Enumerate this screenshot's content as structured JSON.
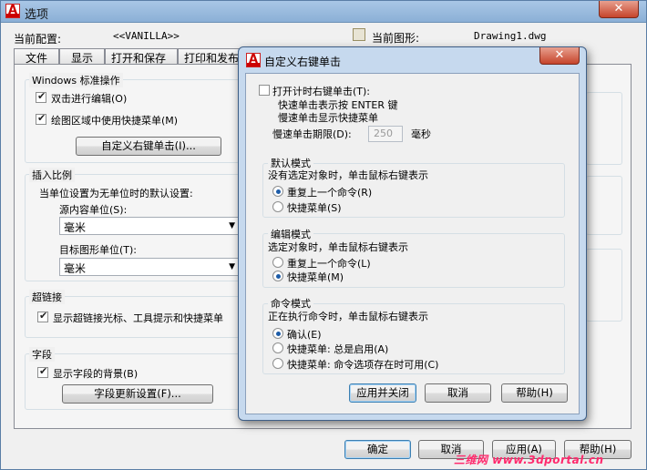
{
  "main": {
    "title": "选项",
    "close_label": "✕",
    "current_config_label": "当前配置:",
    "current_config_value": "<<VANILLA>>",
    "current_drawing_label": "当前图形:",
    "current_drawing_value": "Drawing1.dwg",
    "tabs": [
      "文件",
      "显示",
      "打开和保存",
      "打印和发布",
      "系"
    ],
    "windows_group": {
      "title": "Windows 标准操作",
      "double_click_edit": "双击进行编辑(O)",
      "shortcut_menu": "绘图区域中使用快捷菜单(M)",
      "custom_right_click_button": "自定义右键单击(I)..."
    },
    "insert_scale_group": {
      "title": "插入比例",
      "desc": "当单位设置为无单位时的默认设置:",
      "source_label": "源内容单位(S):",
      "source_value": "毫米",
      "target_label": "目标图形单位(T):",
      "target_value": "毫米"
    },
    "hyperlink_group": {
      "title": "超链接",
      "show_cursor": "显示超链接光标、工具提示和快捷菜单"
    },
    "field_group": {
      "title": "字段",
      "show_background": "显示字段的背景(B)",
      "update_settings_button": "字段更新设置(F)..."
    },
    "footer": {
      "ok": "确定",
      "cancel": "取消",
      "apply": "应用(A)",
      "help": "帮助(H)"
    }
  },
  "dialog": {
    "title": "自定义右键单击",
    "close_label": "✕",
    "timed_right_click": "打开计时右键单击(T):",
    "quick_click_desc": "快速单击表示按 ENTER 键",
    "slow_click_desc": "慢速单击显示快捷菜单",
    "slow_click_duration_label": "慢速单击期限(D):",
    "slow_click_duration_value": "250",
    "duration_unit": "毫秒",
    "default_mode": {
      "title": "默认模式",
      "desc": "没有选定对象时，单击鼠标右键表示",
      "options": [
        "重复上一个命令(R)",
        "快捷菜单(S)"
      ],
      "selected": 0
    },
    "edit_mode": {
      "title": "编辑模式",
      "desc": "选定对象时，单击鼠标右键表示",
      "options": [
        "重复上一个命令(L)",
        "快捷菜单(M)"
      ],
      "selected": 1
    },
    "command_mode": {
      "title": "命令模式",
      "desc": "正在执行命令时，单击鼠标右键表示",
      "options": [
        "确认(E)",
        "快捷菜单: 总是启用(A)",
        "快捷菜单: 命令选项存在时可用(C)"
      ],
      "selected": 0
    },
    "buttons": {
      "apply_close": "应用并关闭",
      "cancel": "取消",
      "help": "帮助(H)"
    }
  },
  "watermark": "三维网 www.3dportal.cn"
}
